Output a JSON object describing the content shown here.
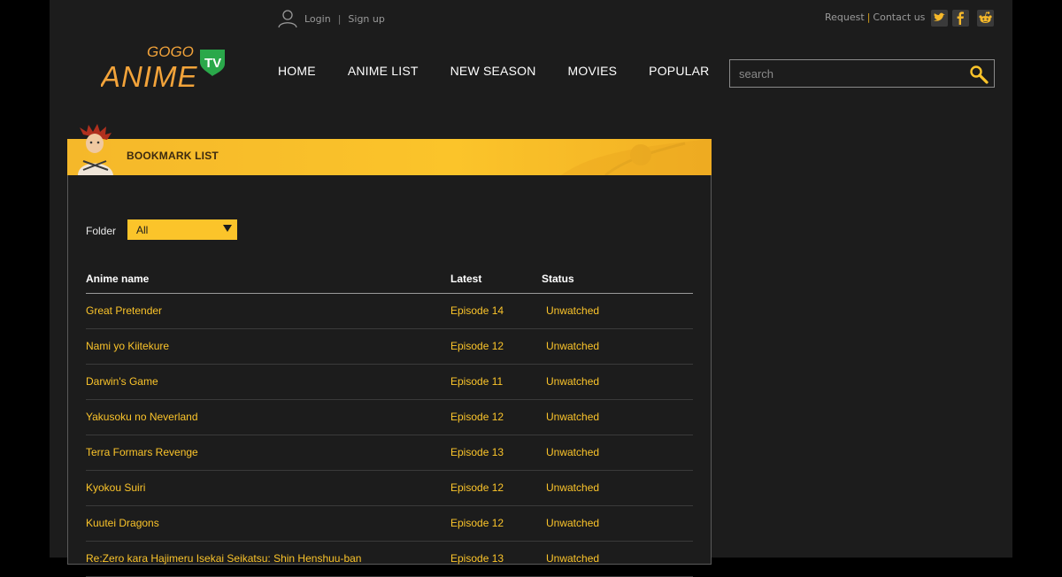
{
  "header": {
    "login_label": "Login",
    "signup_label": "Sign up",
    "request_label": "Request",
    "contact_label": "Contact us",
    "social": [
      "twitter-icon",
      "facebook-icon",
      "reddit-icon"
    ]
  },
  "logo": {
    "top_text": "GOGO",
    "main_text": "ANIME",
    "badge_text": "TV"
  },
  "nav": {
    "items": [
      "HOME",
      "ANIME LIST",
      "NEW SEASON",
      "MOVIES",
      "POPULAR"
    ]
  },
  "search": {
    "placeholder": "search"
  },
  "bookmark": {
    "title": "BOOKMARK LIST",
    "folder_label": "Folder",
    "folder_value": "All",
    "columns": [
      "Anime name",
      "Latest",
      "Status"
    ],
    "rows": [
      {
        "name": "Great Pretender",
        "latest": "Episode 14",
        "status": "Unwatched"
      },
      {
        "name": "Nami yo Kiitekure",
        "latest": "Episode 12",
        "status": "Unwatched"
      },
      {
        "name": "Darwin's Game",
        "latest": "Episode 11",
        "status": "Unwatched"
      },
      {
        "name": "Yakusoku no Neverland",
        "latest": "Episode 12",
        "status": "Unwatched"
      },
      {
        "name": "Terra Formars Revenge",
        "latest": "Episode 13",
        "status": "Unwatched"
      },
      {
        "name": "Kyokou Suiri",
        "latest": "Episode 12",
        "status": "Unwatched"
      },
      {
        "name": "Kuutei Dragons",
        "latest": "Episode 12",
        "status": "Unwatched"
      },
      {
        "name": "Re:Zero kara Hajimeru Isekai Seikatsu: Shin Henshuu-ban",
        "latest": "Episode 13",
        "status": "Unwatched"
      }
    ]
  },
  "colors": {
    "accent": "#fbc42a",
    "background": "#1c1c1c",
    "logo_orange": "#f2a33a",
    "badge_green": "#2aa84a"
  }
}
